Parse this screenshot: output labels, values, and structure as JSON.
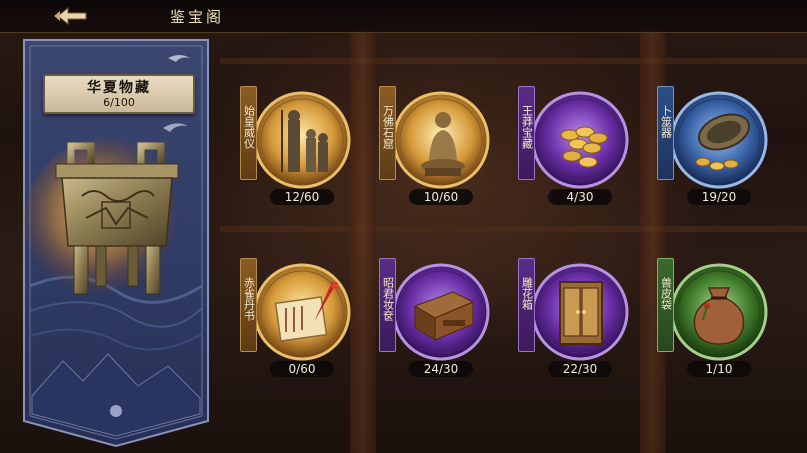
{
  "header": {
    "title": "鉴宝阁",
    "back_icon": "back-arrow-icon"
  },
  "collection": {
    "name": "华夏物藏",
    "progress": "6/100",
    "image": "bronze-ding-cauldron"
  },
  "items": [
    {
      "name": "始皇威仪",
      "progress": "12/60",
      "rarity": "gold",
      "image": "terracotta-warriors"
    },
    {
      "name": "万佛石窟",
      "progress": "10/60",
      "rarity": "gold",
      "image": "buddha-statue"
    },
    {
      "name": "王莽宝藏",
      "progress": "4/30",
      "rarity": "purple",
      "image": "gold-coins"
    },
    {
      "name": "卜筮器",
      "progress": "19/20",
      "rarity": "blue",
      "image": "bronze-divination-bowl"
    },
    {
      "name": "赤雀丹书",
      "progress": "0/60",
      "rarity": "gold",
      "image": "scroll-and-brush"
    },
    {
      "name": "昭君妆奁",
      "progress": "24/30",
      "rarity": "purple",
      "image": "makeup-box"
    },
    {
      "name": "雕花箱",
      "progress": "22/30",
      "rarity": "purple",
      "image": "carved-cabinet"
    },
    {
      "name": "兽皮袋",
      "progress": "1/10",
      "rarity": "green",
      "image": "leather-pouch"
    }
  ],
  "colors": {
    "gold": "#d9a54a",
    "purple": "#8a4fc9",
    "blue": "#3e6fb8",
    "green": "#4f8a3a",
    "banner": "#3a4a7a"
  }
}
